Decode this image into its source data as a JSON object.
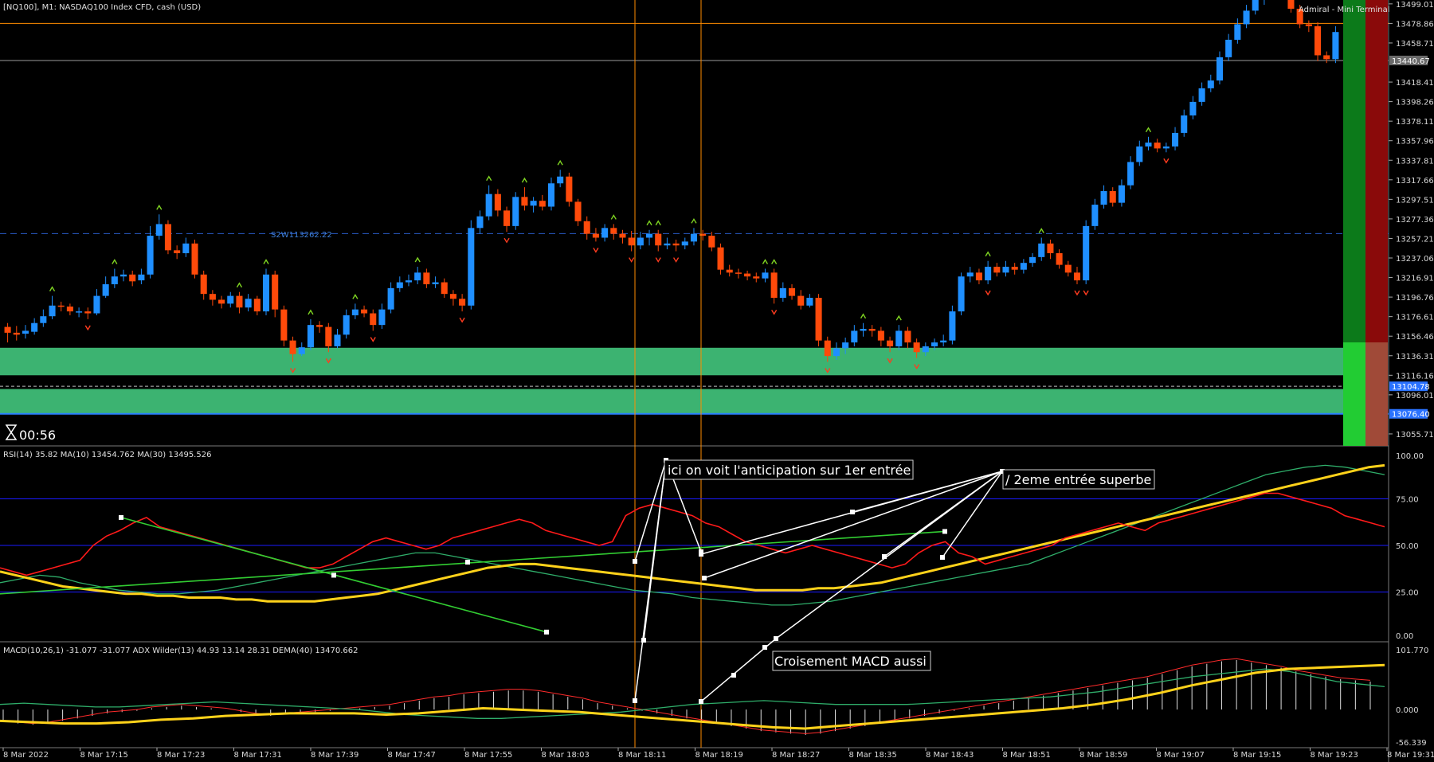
{
  "window": {
    "symbol_title": "[NQ100], M1:  NASDAQ100 Index CFD, cash (USD)",
    "terminal_label": "Admiral - Mini Terminal",
    "timer": "00:56"
  },
  "colors": {
    "bull": "#1f8fff",
    "bear": "#ff4a0a",
    "zone": "#3cb371",
    "rsi": "#ff1a1a",
    "ma_yellow": "#ffd21a",
    "ma_green": "#2fae6a",
    "trend_green": "#32cd32",
    "grid_blue": "#1a1aff",
    "vline": "#ff8c00"
  },
  "main": {
    "price_ticks": [
      "13499.01",
      "13478.86",
      "13458.71",
      "13418.41",
      "13398.26",
      "13378.11",
      "13357.96",
      "13337.81",
      "13317.66",
      "13297.51",
      "13277.36",
      "13257.21",
      "13237.06",
      "13216.91",
      "13196.76",
      "13176.61",
      "13156.46",
      "13136.31",
      "13116.16",
      "13096.01",
      "13055.71"
    ],
    "price_range": [
      13045,
      13503
    ],
    "current_price_label": "13440.67",
    "level_labels": [
      "13104.78",
      "13076.40"
    ],
    "sr_label": "S2W113262.22",
    "hline_levels": [
      13478.86,
      13440.67,
      13262.22,
      13104.78,
      13076.4
    ],
    "zones": [
      [
        13116.16,
        13144.5
      ],
      [
        13076.4,
        13102.0
      ]
    ],
    "candles": [
      [
        13166,
        13160,
        13170,
        13150
      ],
      [
        13160,
        13158,
        13167,
        13152
      ],
      [
        13159,
        13162,
        13168,
        13154
      ],
      [
        13161,
        13170,
        13175,
        13158
      ],
      [
        13170,
        13177,
        13184,
        13166
      ],
      [
        13177,
        13188,
        13198,
        13174
      ],
      [
        13188,
        13187,
        13192,
        13182
      ],
      [
        13187,
        13182,
        13190,
        13178
      ],
      [
        13182,
        13182,
        13186,
        13176
      ],
      [
        13182,
        13180,
        13186,
        13174
      ],
      [
        13180,
        13198,
        13205,
        13178
      ],
      [
        13198,
        13210,
        13218,
        13196
      ],
      [
        13210,
        13218,
        13226,
        13206
      ],
      [
        13218,
        13220,
        13225,
        13213
      ],
      [
        13220,
        13213,
        13224,
        13208
      ],
      [
        13214,
        13220,
        13226,
        13210
      ],
      [
        13220,
        13260,
        13270,
        13216
      ],
      [
        13260,
        13272,
        13282,
        13256
      ],
      [
        13272,
        13245,
        13276,
        13241
      ],
      [
        13245,
        13242,
        13250,
        13236
      ],
      [
        13242,
        13252,
        13258,
        13238
      ],
      [
        13252,
        13220,
        13256,
        13216
      ],
      [
        13220,
        13200,
        13224,
        13194
      ],
      [
        13200,
        13194,
        13204,
        13188
      ],
      [
        13194,
        13190,
        13198,
        13185
      ],
      [
        13190,
        13198,
        13202,
        13186
      ],
      [
        13198,
        13186,
        13202,
        13180
      ],
      [
        13186,
        13195,
        13200,
        13182
      ],
      [
        13195,
        13182,
        13198,
        13178
      ],
      [
        13182,
        13220,
        13226,
        13178
      ],
      [
        13220,
        13184,
        13224,
        13176
      ],
      [
        13184,
        13152,
        13188,
        13146
      ],
      [
        13152,
        13138,
        13156,
        13130
      ],
      [
        13138,
        13145,
        13150,
        13136
      ],
      [
        13145,
        13168,
        13174,
        13142
      ],
      [
        13168,
        13166,
        13172,
        13160
      ],
      [
        13166,
        13146,
        13170,
        13140
      ],
      [
        13146,
        13158,
        13164,
        13144
      ],
      [
        13158,
        13178,
        13184,
        13154
      ],
      [
        13178,
        13184,
        13190,
        13174
      ],
      [
        13184,
        13180,
        13188,
        13176
      ],
      [
        13180,
        13168,
        13184,
        13162
      ],
      [
        13168,
        13184,
        13190,
        13164
      ],
      [
        13184,
        13206,
        13212,
        13180
      ],
      [
        13206,
        13212,
        13218,
        13202
      ],
      [
        13212,
        13214,
        13220,
        13208
      ],
      [
        13214,
        13222,
        13228,
        13210
      ],
      [
        13222,
        13210,
        13226,
        13206
      ],
      [
        13210,
        13212,
        13218,
        13206
      ],
      [
        13212,
        13200,
        13216,
        13196
      ],
      [
        13200,
        13195,
        13204,
        13188
      ],
      [
        13195,
        13188,
        13200,
        13182
      ],
      [
        13188,
        13268,
        13276,
        13184
      ],
      [
        13268,
        13280,
        13286,
        13262
      ],
      [
        13280,
        13303,
        13312,
        13276
      ],
      [
        13303,
        13286,
        13308,
        13280
      ],
      [
        13286,
        13270,
        13290,
        13264
      ],
      [
        13270,
        13300,
        13305,
        13266
      ],
      [
        13300,
        13291,
        13310,
        13286
      ],
      [
        13291,
        13296,
        13300,
        13284
      ],
      [
        13296,
        13290,
        13302,
        13286
      ],
      [
        13290,
        13314,
        13320,
        13286
      ],
      [
        13314,
        13321,
        13328,
        13310
      ],
      [
        13321,
        13295,
        13325,
        13290
      ],
      [
        13295,
        13275,
        13298,
        13270
      ],
      [
        13275,
        13262,
        13280,
        13256
      ],
      [
        13262,
        13258,
        13268,
        13254
      ],
      [
        13258,
        13268,
        13272,
        13254
      ],
      [
        13268,
        13262,
        13272,
        13256
      ],
      [
        13262,
        13258,
        13266,
        13252
      ],
      [
        13258,
        13250,
        13265,
        13244
      ],
      [
        13250,
        13258,
        13264,
        13246
      ],
      [
        13258,
        13262,
        13266,
        13250
      ],
      [
        13262,
        13250,
        13266,
        13244
      ],
      [
        13250,
        13252,
        13258,
        13246
      ],
      [
        13252,
        13250,
        13256,
        13244
      ],
      [
        13250,
        13254,
        13258,
        13246
      ],
      [
        13254,
        13262,
        13268,
        13250
      ],
      [
        13262,
        13260,
        13266,
        13255
      ],
      [
        13260,
        13248,
        13264,
        13244
      ],
      [
        13248,
        13225,
        13252,
        13220
      ],
      [
        13225,
        13222,
        13230,
        13218
      ],
      [
        13222,
        13221,
        13226,
        13216
      ],
      [
        13221,
        13218,
        13224,
        13214
      ],
      [
        13218,
        13216,
        13222,
        13212
      ],
      [
        13216,
        13222,
        13226,
        13212
      ],
      [
        13222,
        13196,
        13226,
        13190
      ],
      [
        13196,
        13206,
        13212,
        13192
      ],
      [
        13206,
        13198,
        13210,
        13194
      ],
      [
        13198,
        13188,
        13204,
        13184
      ],
      [
        13188,
        13196,
        13200,
        13186
      ],
      [
        13196,
        13152,
        13200,
        13146
      ],
      [
        13152,
        13136,
        13156,
        13130
      ],
      [
        13136,
        13144,
        13150,
        13132
      ],
      [
        13144,
        13150,
        13155,
        13138
      ],
      [
        13150,
        13162,
        13168,
        13146
      ],
      [
        13162,
        13164,
        13170,
        13156
      ],
      [
        13164,
        13162,
        13168,
        13156
      ],
      [
        13162,
        13152,
        13166,
        13146
      ],
      [
        13152,
        13146,
        13156,
        13140
      ],
      [
        13146,
        13162,
        13168,
        13142
      ],
      [
        13162,
        13150,
        13166,
        13144
      ],
      [
        13150,
        13140,
        13154,
        13134
      ],
      [
        13140,
        13146,
        13150,
        13136
      ],
      [
        13146,
        13150,
        13154,
        13142
      ],
      [
        13150,
        13152,
        13158,
        13146
      ],
      [
        13152,
        13182,
        13188,
        13148
      ],
      [
        13182,
        13218,
        13222,
        13178
      ],
      [
        13218,
        13222,
        13228,
        13212
      ],
      [
        13222,
        13214,
        13226,
        13210
      ],
      [
        13214,
        13228,
        13234,
        13210
      ],
      [
        13228,
        13222,
        13232,
        13218
      ],
      [
        13222,
        13228,
        13234,
        13218
      ],
      [
        13228,
        13225,
        13232,
        13220
      ],
      [
        13225,
        13232,
        13236,
        13221
      ],
      [
        13232,
        13238,
        13242,
        13228
      ],
      [
        13238,
        13252,
        13258,
        13234
      ],
      [
        13252,
        13242,
        13256,
        13236
      ],
      [
        13242,
        13230,
        13246,
        13226
      ],
      [
        13230,
        13222,
        13234,
        13218
      ],
      [
        13222,
        13214,
        13228,
        13210
      ],
      [
        13214,
        13270,
        13276,
        13210
      ],
      [
        13270,
        13292,
        13298,
        13266
      ],
      [
        13292,
        13306,
        13312,
        13288
      ],
      [
        13306,
        13294,
        13310,
        13290
      ],
      [
        13294,
        13312,
        13318,
        13290
      ],
      [
        13312,
        13336,
        13342,
        13308
      ],
      [
        13336,
        13352,
        13358,
        13332
      ],
      [
        13352,
        13356,
        13362,
        13348
      ],
      [
        13356,
        13350,
        13360,
        13346
      ],
      [
        13350,
        13352,
        13356,
        13346
      ],
      [
        13352,
        13366,
        13372,
        13348
      ],
      [
        13366,
        13384,
        13390,
        13362
      ],
      [
        13384,
        13398,
        13404,
        13380
      ],
      [
        13398,
        13412,
        13418,
        13394
      ],
      [
        13412,
        13420,
        13426,
        13408
      ],
      [
        13420,
        13444,
        13450,
        13416
      ],
      [
        13444,
        13462,
        13468,
        13440
      ],
      [
        13462,
        13478,
        13484,
        13458
      ],
      [
        13478,
        13492,
        13498,
        13474
      ],
      [
        13492,
        13503,
        13508,
        13488
      ],
      [
        13503,
        13512,
        13516,
        13498
      ],
      [
        13512,
        13518,
        13522,
        13508
      ],
      [
        13518,
        13510,
        13522,
        13504
      ],
      [
        13510,
        13494,
        13514,
        13490
      ],
      [
        13494,
        13478,
        13498,
        13474
      ],
      [
        13478,
        13476,
        13482,
        13470
      ],
      [
        13476,
        13446,
        13480,
        13440
      ],
      [
        13446,
        13442,
        13450,
        13438
      ],
      [
        13442,
        13470,
        13476,
        13438
      ]
    ]
  },
  "rsi": {
    "title": "RSI(14) 35.82 MA(10) 13454.762 MA(30) 13495.526",
    "levels": [
      "100.00",
      "75.00",
      "50.00",
      "25.00",
      "0.00"
    ],
    "annotation_1": "ici on voit l'anticipation sur 1er entrée",
    "annotation_2": "/ 2eme entrée superbe"
  },
  "macd": {
    "title": "MACD(10,26,1) -31.077 -31.077 ADX Wilder(13) 44.93 13.14 28.31 DEMA(40) 13470.662",
    "levels": [
      "101.770",
      "0.000",
      "-56.339"
    ],
    "annotation": "Croisement MACD aussi"
  },
  "time_axis": [
    "8 Mar 2022",
    "8 Mar 17:15",
    "8 Mar 17:23",
    "8 Mar 17:31",
    "8 Mar 17:39",
    "8 Mar 17:47",
    "8 Mar 17:55",
    "8 Mar 18:03",
    "8 Mar 18:11",
    "8 Mar 18:19",
    "8 Mar 18:27",
    "8 Mar 18:35",
    "8 Mar 18:43",
    "8 Mar 18:51",
    "8 Mar 18:59",
    "8 Mar 19:07",
    "8 Mar 19:15",
    "8 Mar 19:23",
    "8 Mar 19:31"
  ],
  "chart_data": {
    "type": "candlestick",
    "instrument": "NASDAQ100 Index CFD",
    "timeframe": "M1",
    "indicators": [
      "RSI(14)",
      "MA(10)",
      "MA(30)",
      "MACD(10,26,1)",
      "ADX Wilder(13)",
      "DEMA(40)"
    ],
    "price_axis_range": [
      13045,
      13503
    ],
    "rsi_range": [
      0,
      100
    ],
    "macd_range": [
      -56.339,
      101.77
    ]
  }
}
